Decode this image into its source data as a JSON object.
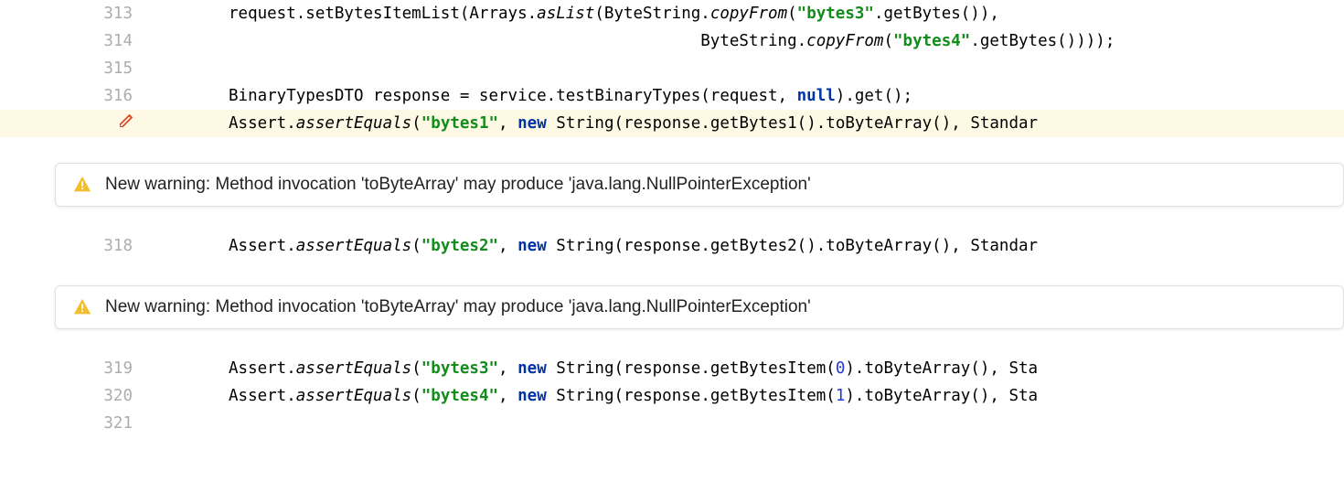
{
  "lines": {
    "l313": {
      "num": "313",
      "t1": "request.setBytesItemList(Arrays.",
      "t2": "asList",
      "t3": "(ByteString.",
      "t4": "copyFrom",
      "t5": "(",
      "t6": "\"bytes3\"",
      "t7": ".getBytes()),"
    },
    "l314": {
      "num": "314",
      "pad": "                                                 ",
      "t1": "ByteString.",
      "t2": "copyFrom",
      "t3": "(",
      "t4": "\"bytes4\"",
      "t5": ".getBytes())));"
    },
    "l315": {
      "num": "315"
    },
    "l316": {
      "num": "316",
      "t1": "BinaryTypesDTO response = service.testBinaryTypes(request, ",
      "t2": "null",
      "t3": ").get();"
    },
    "l317": {
      "t1": "Assert.",
      "t2": "assertEquals",
      "t3": "(",
      "t4": "\"bytes1\"",
      "t5": ", ",
      "t6": "new ",
      "t7": "String(response.getBytes1().toByteArray(), Standar"
    },
    "l318": {
      "num": "318",
      "t1": "Assert.",
      "t2": "assertEquals",
      "t3": "(",
      "t4": "\"bytes2\"",
      "t5": ", ",
      "t6": "new ",
      "t7": "String(response.getBytes2().toByteArray(), Standar"
    },
    "l319": {
      "num": "319",
      "t1": "Assert.",
      "t2": "assertEquals",
      "t3": "(",
      "t4": "\"bytes3\"",
      "t5": ", ",
      "t6": "new ",
      "t7": "String(response.getBytesItem(",
      "t8": "0",
      "t9": ").toByteArray(), Sta"
    },
    "l320": {
      "num": "320",
      "t1": "Assert.",
      "t2": "assertEquals",
      "t3": "(",
      "t4": "\"bytes4\"",
      "t5": ", ",
      "t6": "new ",
      "t7": "String(response.getBytesItem(",
      "t8": "1",
      "t9": ").toByteArray(), Sta"
    },
    "l321": {
      "num": "321"
    }
  },
  "warnings": {
    "w1": "New warning: Method invocation 'toByteArray' may produce 'java.lang.NullPointerException'",
    "w2": "New warning: Method invocation 'toByteArray' may produce 'java.lang.NullPointerException'"
  }
}
